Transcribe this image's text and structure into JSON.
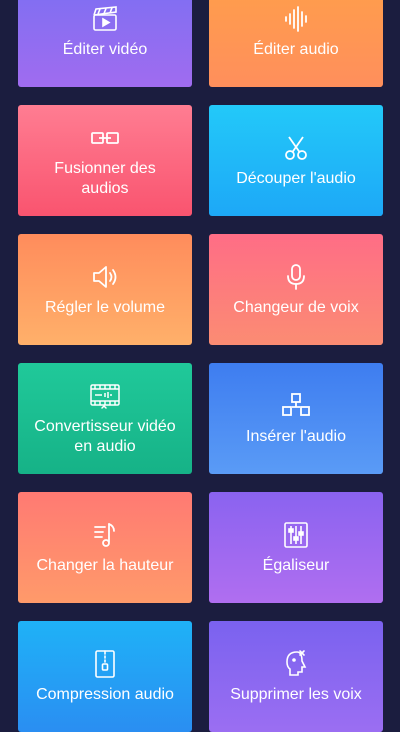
{
  "tiles": [
    {
      "label": "Éditer vidéo",
      "icon": "clapperboard-icon"
    },
    {
      "label": "Éditer audio",
      "icon": "waveform-icon"
    },
    {
      "label": "Fusionner des\naudios",
      "icon": "merge-icon"
    },
    {
      "label": "Découper l'audio",
      "icon": "scissors-icon"
    },
    {
      "label": "Régler le volume",
      "icon": "speaker-icon"
    },
    {
      "label": "Changeur de voix",
      "icon": "microphone-icon"
    },
    {
      "label": "Convertisseur vidéo\nen audio",
      "icon": "video-to-audio-icon"
    },
    {
      "label": "Insérer l'audio",
      "icon": "insert-blocks-icon"
    },
    {
      "label": "Changer la hauteur",
      "icon": "pitch-icon"
    },
    {
      "label": "Égaliseur",
      "icon": "equalizer-icon"
    },
    {
      "label": "Compression audio",
      "icon": "zip-file-icon"
    },
    {
      "label": "Supprimer les voix",
      "icon": "voice-remove-icon"
    }
  ],
  "colors": {
    "background": "#1b1d3f",
    "edit_video": "#8c6df1",
    "edit_audio": "#ff9752",
    "merge": "#fb6880",
    "cut": "#20b8f8",
    "volume": "#ff9e63",
    "voice": "#fc7c7c",
    "convert": "#1bbe91",
    "insert": "#4c8cf3",
    "pitch": "#ff8a6e",
    "equalizer": "#9d68f0",
    "compress": "#24a0f4",
    "remove_voice": "#8a68f0"
  }
}
